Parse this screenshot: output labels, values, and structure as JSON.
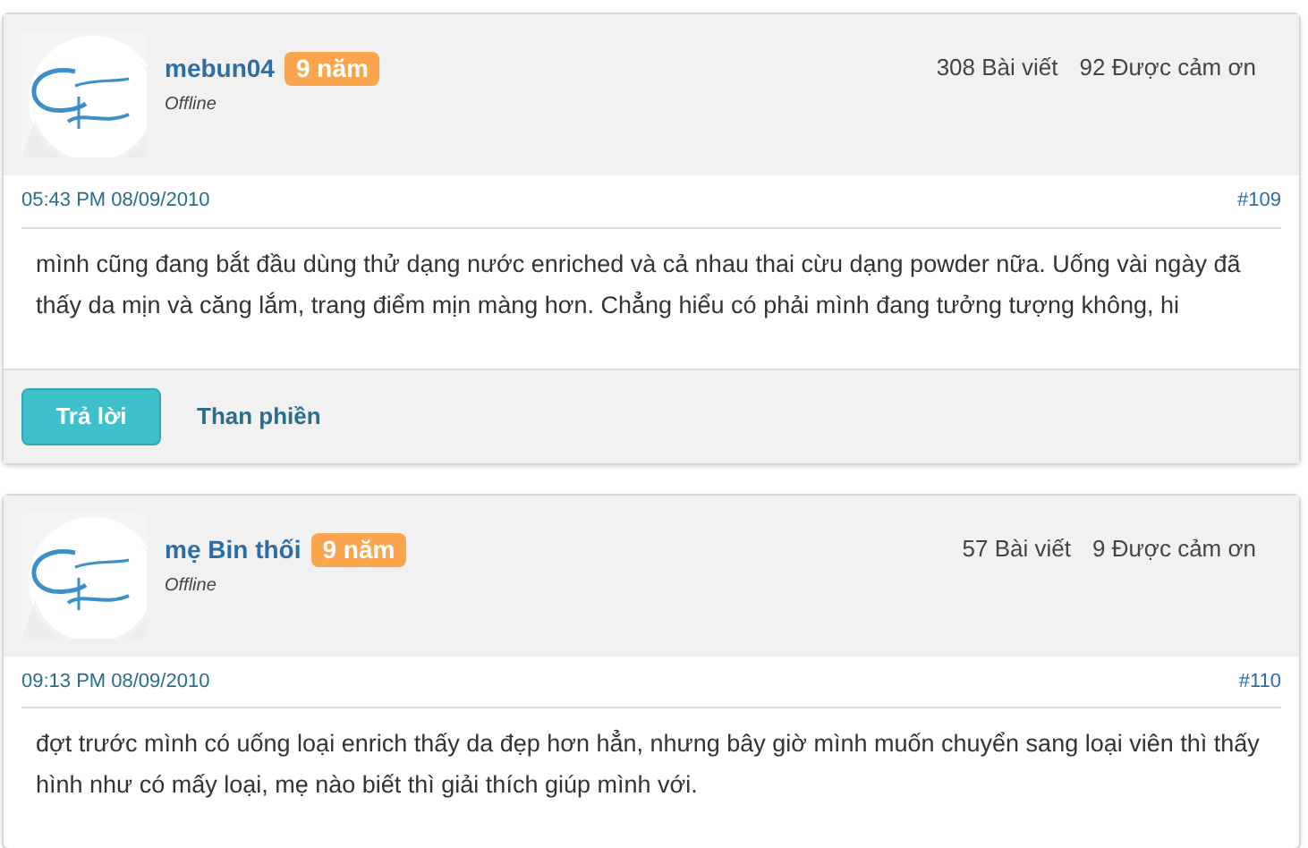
{
  "posts": [
    {
      "username": "mebun04",
      "badge": "9 năm",
      "status": "Offline",
      "posts_count": "308 Bài viết",
      "thanks": "92 Được cảm ơn",
      "time": "05:43 PM 08/09/2010",
      "number": "#109",
      "body": "mình cũng đang bắt đầu dùng thử dạng nước enriched và cả nhau thai cừu dạng powder nữa. Uống vài ngày đã thấy da mịn và căng lắm, trang điểm mịn màng hơn. Chẳng hiểu có phải mình đang tưởng tượng không, hi",
      "actions": {
        "reply": "Trả lời",
        "report": "Than phiền"
      }
    },
    {
      "username": "mẹ Bin thối",
      "badge": "9 năm",
      "status": "Offline",
      "posts_count": "57 Bài viết",
      "thanks": "9 Được cảm ơn",
      "time": "09:13 PM 08/09/2010",
      "number": "#110",
      "body": "đợt trước mình có uống loại enrich thấy da đẹp hơn hẳn, nhưng bây giờ mình muốn chuyển sang loại viên thì thấy hình như có mấy loại, mẹ nào biết thì giải thích giúp mình với."
    }
  ]
}
